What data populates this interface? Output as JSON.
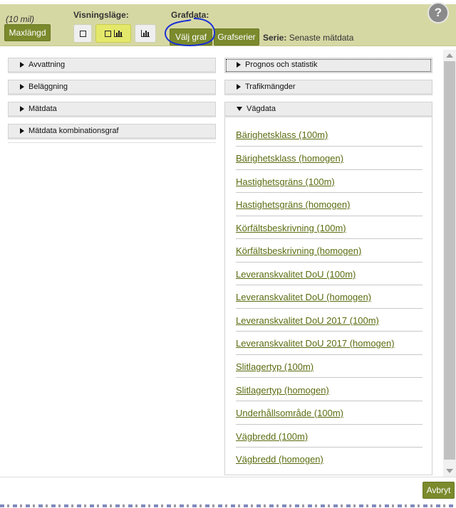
{
  "toolbar": {
    "distance_note": "(10 mil)",
    "maxlangd_label": "Maxlängd",
    "visningslage_label": "Visningsläge:",
    "grafdata_label": "Grafdata:",
    "valj_graf_label": "Välj graf",
    "grafserier_label": "Grafserier",
    "serie_prefix": "Serie:",
    "serie_value": "Senaste mätdata",
    "help_label": "?",
    "view_modes": [
      {
        "icon": "map-only-icon",
        "active": false
      },
      {
        "icon": "map-and-chart-icon",
        "active": true
      },
      {
        "icon": "chart-only-icon",
        "active": false
      }
    ]
  },
  "left_sections": [
    {
      "label": "Avvattning"
    },
    {
      "label": "Beläggning"
    },
    {
      "label": "Mätdata"
    },
    {
      "label": "Mätdata kombinationsgraf"
    }
  ],
  "right_sections": [
    {
      "label": "Prognos och statistik",
      "expanded": false
    },
    {
      "label": "Trafikmängder",
      "expanded": false
    },
    {
      "label": "Vägdata",
      "expanded": true
    }
  ],
  "vagdata_items": [
    "Bärighetsklass (100m)",
    "Bärighetsklass (homogen)",
    "Hastighetsgräns (100m)",
    "Hastighetsgräns (homogen)",
    "Körfältsbeskrivning (100m)",
    "Körfältsbeskrivning (homogen)",
    "Leveranskvalitet DoU (100m)",
    "Leveranskvalitet DoU (homogen)",
    "Leveranskvalitet DoU 2017 (100m)",
    "Leveranskvalitet DoU 2017 (homogen)",
    "Slitlagertyp (100m)",
    "Slitlagertyp (homogen)",
    "Underhållsområde (100m)",
    "Vägbredd (100m)",
    "Vägbredd (homogen)"
  ],
  "footer": {
    "cancel_label": "Avbryt"
  },
  "colors": {
    "toolbar_bg": "#d6d8a4",
    "button_bg": "#7b8a2c",
    "link": "#5a6c10",
    "annotation": "#1a2fd6"
  }
}
